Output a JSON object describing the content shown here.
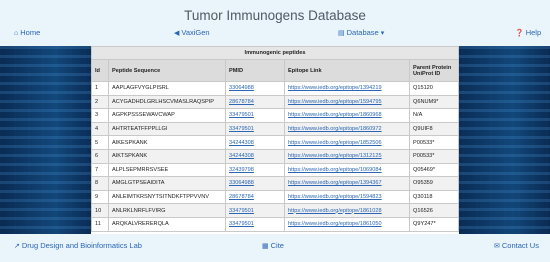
{
  "header": {
    "title": "Tumor Immunogens Database"
  },
  "nav": {
    "home": "Home",
    "vaxigen": "VaxiGen",
    "database": "Database",
    "help": "Help"
  },
  "table": {
    "caption": "Immunogenic peptides",
    "columns": [
      "Id",
      "Peptide Sequence",
      "PMID",
      "Epitope Link",
      "Parent Protein UniProt ID"
    ],
    "rows": [
      [
        "1",
        "AAPLAGFVYGLPISRL",
        "33064988",
        "https://www.iedb.org/epitope/1394219",
        "Q15120"
      ],
      [
        "2",
        "ACYGADHDLGRLHSCVMASLRAQSPIP",
        "28678784",
        "https://www.iedb.org/epitope/1594795",
        "Q6NUM9*"
      ],
      [
        "3",
        "AGPKPSSSEWAVCWAP",
        "33479501",
        "https://www.iedb.org/epitope/1860968",
        "N/A"
      ],
      [
        "4",
        "AHTRTEATFFPPLLGI",
        "33479501",
        "https://www.iedb.org/epitope/1860972",
        "Q9UIF8"
      ],
      [
        "5",
        "AIKESPKANK",
        "34244308",
        "https://www.iedb.org/epitope/1852506",
        "P00533*"
      ],
      [
        "6",
        "AIKTSPKANK",
        "34244308",
        "https://www.iedb.org/epitope/1312125",
        "P00533*"
      ],
      [
        "7",
        "ALPLSEPMRRSVSEE",
        "32439798",
        "https://www.iedb.org/epitope/1069084",
        "Q05469*"
      ],
      [
        "8",
        "AMGLGTPSEAIDITA",
        "33064988",
        "https://www.iedb.org/epitope/1394367",
        "O95359"
      ],
      [
        "9",
        "ANLEIMTKRSNYTSITNDKFTPPVVNV",
        "28678784",
        "https://www.iedb.org/epitope/1594823",
        "Q30118"
      ],
      [
        "10",
        "ANLRKLNRFLFVIRG",
        "33479501",
        "https://www.iedb.org/epitope/1861028",
        "Q16526"
      ],
      [
        "11",
        "ARQKALVRERERQLA",
        "33479501",
        "https://www.iedb.org/epitope/1861050",
        "Q9Y247*"
      ]
    ]
  },
  "footer": {
    "lab": "Drug Design and Bioinformatics Lab",
    "cite": "Cite",
    "contact": "Contact Us"
  },
  "colors": {
    "link": "#2a66b3",
    "page_bg": "#eaf4fb",
    "title": "#4f5a64"
  },
  "icons": {
    "home": "home-icon",
    "vaxigen": "arrow-left-icon",
    "database": "database-icon",
    "help": "question-circle-icon",
    "lab": "external-link-icon",
    "cite": "book-icon",
    "contact": "envelope-icon"
  }
}
